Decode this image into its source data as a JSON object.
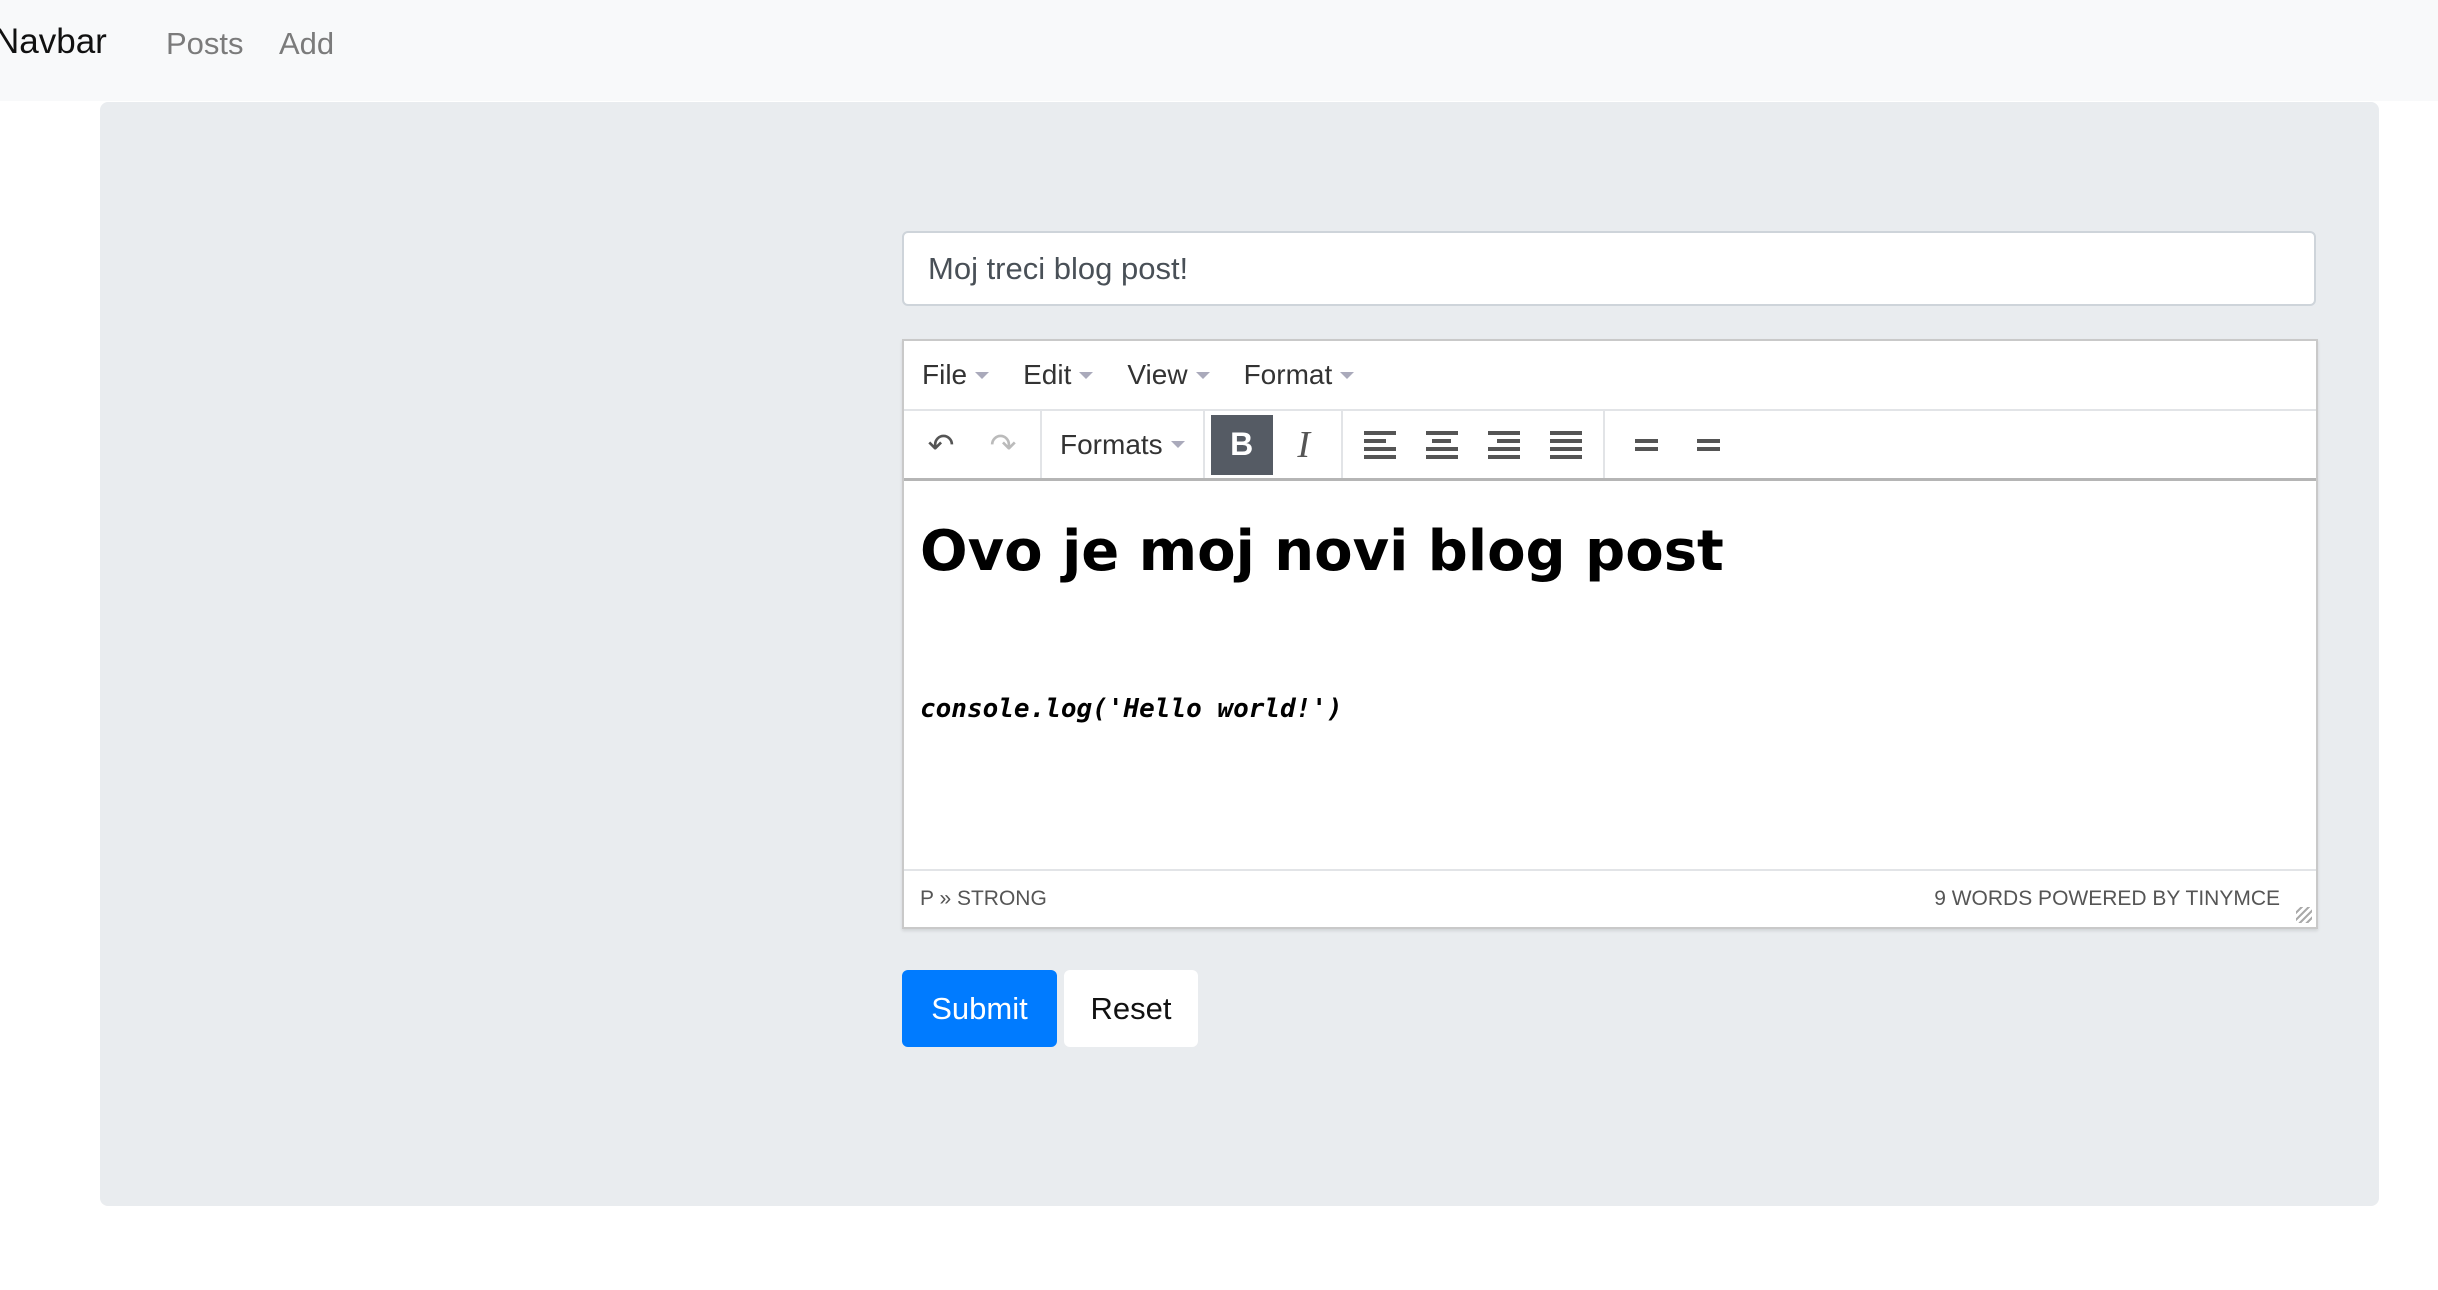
{
  "navbar": {
    "brand": "Navbar",
    "links": [
      "Posts",
      "Add"
    ]
  },
  "form": {
    "title_value": "Moj treci blog post!",
    "submit_label": "Submit",
    "reset_label": "Reset"
  },
  "editor": {
    "menus": [
      "File",
      "Edit",
      "View",
      "Format"
    ],
    "formats_label": "Formats",
    "bold_label": "B",
    "italic_label": "I",
    "heading": "Ovo je moj novi blog post",
    "code": "console.log('Hello world!')",
    "path": "P » STRONG",
    "status_right": "9 WORDS POWERED BY TINYMCE"
  },
  "colors": {
    "primary": "#007bff",
    "jumbotron": "#e9ecef",
    "navbar": "#f8f9fa",
    "active_button": "#555b64"
  }
}
